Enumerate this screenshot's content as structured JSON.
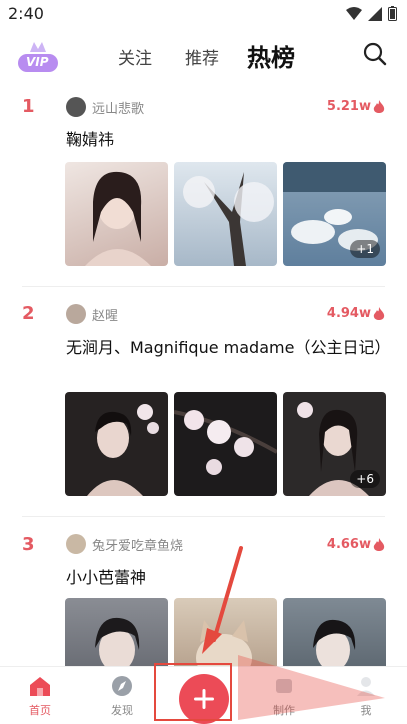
{
  "status": {
    "time": "2:40"
  },
  "topnav": {
    "vip": "VIP",
    "tabs": [
      "关注",
      "推荐",
      "热榜"
    ]
  },
  "posts": [
    {
      "rank": "1",
      "user": "远山悲歌",
      "hot": "5.21w",
      "title": "鞠婧祎",
      "more": "+1",
      "img_colors": [
        "#d9c4bc",
        "#c8d2dc",
        "#9fb6cc"
      ]
    },
    {
      "rank": "2",
      "user": "赵暒",
      "hot": "4.94w",
      "title": "无涧月、Magnifique madame（公主日记）",
      "more": "+6",
      "img_colors": [
        "#2a2624",
        "#1f1d1e",
        "#2c2a2a"
      ]
    },
    {
      "rank": "3",
      "user": "兔牙爱吃章鱼烧",
      "hot": "4.66w",
      "title": "小小芭蕾神",
      "more": "",
      "img_colors": [
        "#6d7078",
        "#b9a796",
        "#5f6a74"
      ]
    }
  ],
  "bottomnav": {
    "home": "首页",
    "discover": "发现",
    "make": "制作",
    "me": "我"
  },
  "colors": {
    "accent": "#e45a62",
    "plus": "#ec4b57",
    "annotation": "#e4493e"
  }
}
